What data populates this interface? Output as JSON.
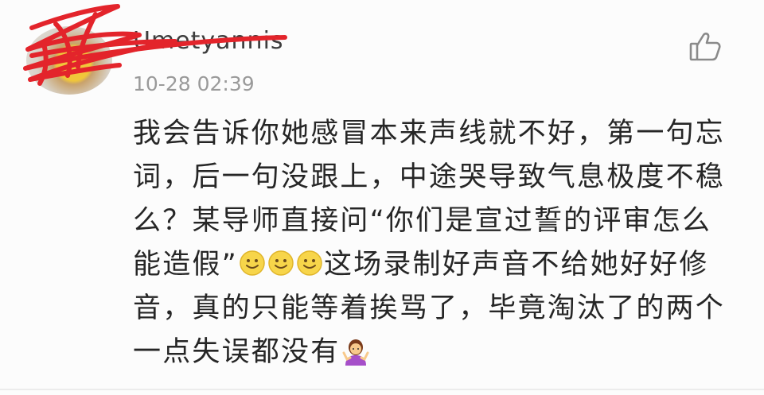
{
  "comment": {
    "username": "Umetyannis",
    "timestamp": "10-28 02:39",
    "avatar_icon": "avatar",
    "like_icon": "thumbs-up-icon",
    "text_part1": "我会告诉你她感冒本来声线就不好，第一句忘词，后一句没跟上，中途哭导致气息极度不稳么？某导师直接问“你们是宣过誓的评审怎么能造假”",
    "emoji_inline": [
      "smiley-emoji",
      "smiley-emoji",
      "smiley-emoji"
    ],
    "text_part2": "这场录制好声音不给她好好修音，真的只能等着挨骂了，毕竟淘汰了的两个一点失误都没有",
    "emoji_end": "person-shrugging-emoji"
  },
  "colors": {
    "scribble_red": "#e3242b",
    "username_text": "#3d3d3d",
    "timestamp_text": "#9a9a9a",
    "body_text": "#262626",
    "icon_gray": "#8a8a8a"
  }
}
